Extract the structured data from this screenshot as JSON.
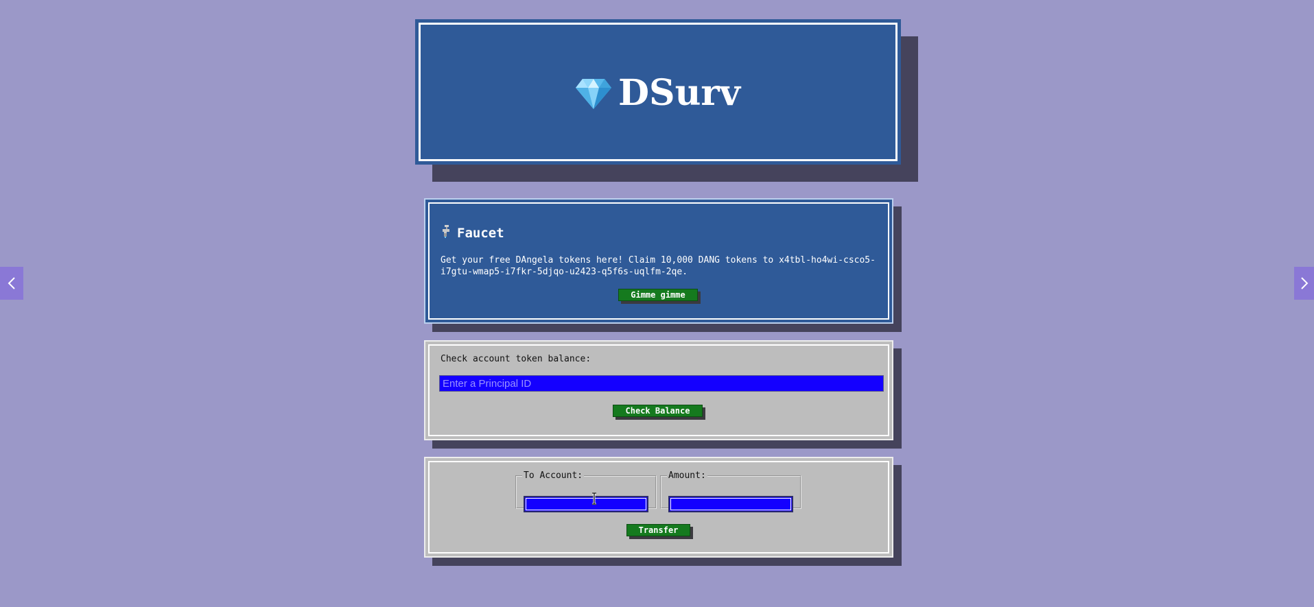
{
  "header": {
    "brand_name": "DSurv",
    "logo_icon": "diamond-icon"
  },
  "faucet": {
    "icon": "faucet-icon",
    "title": "Faucet",
    "description": "Get your free DAngela tokens here! Claim 10,000 DANG tokens to x4tbl-ho4wi-csco5-i7gtu-wmap5-i7fkr-5djqo-u2423-q5f6s-uqlfm-2qe.",
    "button_label": "Gimme gimme"
  },
  "balance": {
    "label": "Check account token balance:",
    "input_placeholder": "Enter a Principal ID",
    "button_label": "Check Balance"
  },
  "transfer": {
    "to_account_label": "To Account:",
    "amount_label": "Amount:",
    "button_label": "Transfer"
  },
  "nav": {
    "prev_icon": "chevron-left-icon",
    "next_icon": "chevron-right-icon"
  },
  "colors": {
    "page_background": "#9b98c8",
    "card_blue": "#2f5a98",
    "card_grey": "#bdbdbd",
    "input_blue": "#1400ff",
    "button_green": "#157a1e",
    "shadow": "#45435c"
  }
}
